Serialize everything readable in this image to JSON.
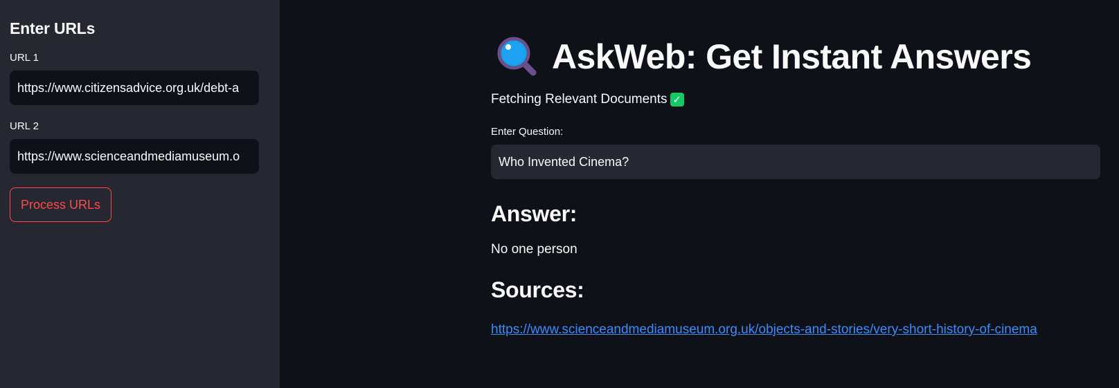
{
  "sidebar": {
    "title": "Enter URLs",
    "url1": {
      "label": "URL 1",
      "value": "https://www.citizensadvice.org.uk/debt-a"
    },
    "url2": {
      "label": "URL 2",
      "value": "https://www.scienceandmediamuseum.o"
    },
    "process_button": "Process URLs"
  },
  "main": {
    "title_icon": "magnifying-glass-icon",
    "title": "AskWeb: Get Instant Answers",
    "status": "Fetching Relevant Documents",
    "status_icon": "check-mark-icon",
    "question_label": "Enter Question:",
    "question_value": "Who Invented Cinema?",
    "answer_heading": "Answer:",
    "answer_text": "No one person",
    "sources_heading": "Sources:",
    "source_link": "https://www.scienceandmediamuseum.org.uk/objects-and-stories/very-short-history-of-cinema"
  },
  "colors": {
    "background": "#0e1117",
    "sidebar": "#262730",
    "accent": "#ff4b4b",
    "link": "#3d8bfd",
    "success": "#17c964"
  }
}
